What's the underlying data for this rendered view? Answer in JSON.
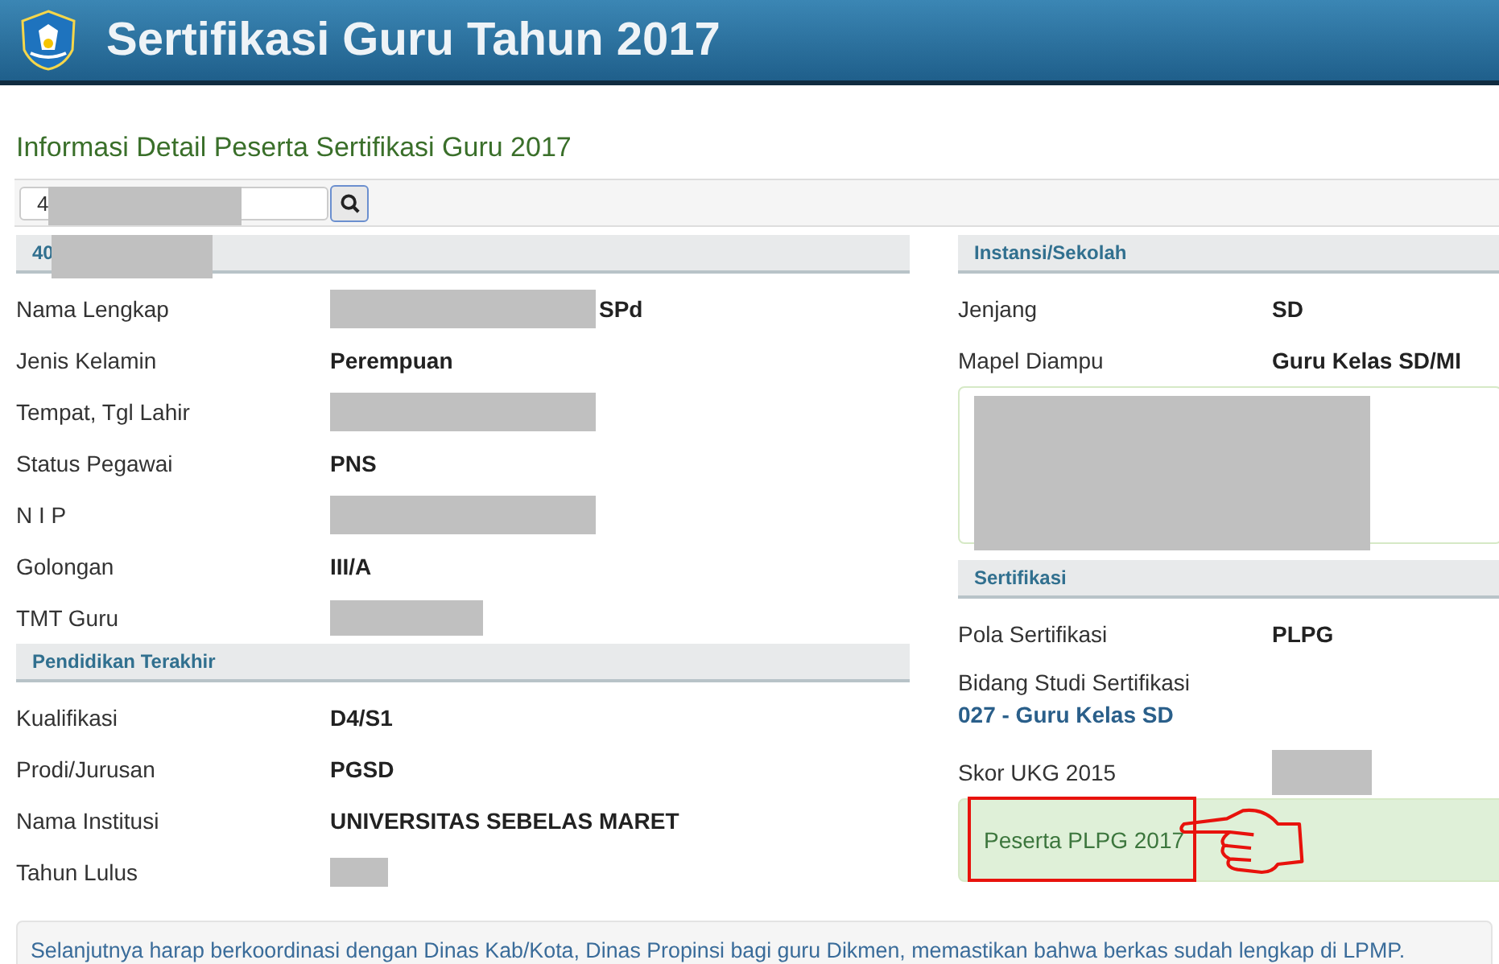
{
  "header": {
    "title": "Sertifikasi Guru Tahun 2017"
  },
  "page_title": "Informasi Detail Peserta Sertifikasi Guru 2017",
  "search": {
    "value": "4",
    "redacted": true
  },
  "left_sections": [
    {
      "heading": "40",
      "heading_redacted": true,
      "rows": [
        {
          "label": "Nama Lengkap",
          "value": "SPd",
          "redacted": true
        },
        {
          "label": "Jenis Kelamin",
          "value": "Perempuan"
        },
        {
          "label": "Tempat, Tgl Lahir",
          "redacted": true
        },
        {
          "label": "Status Pegawai",
          "value": "PNS"
        },
        {
          "label": "N I P",
          "redacted": true
        },
        {
          "label": "Golongan",
          "value": "III/A"
        },
        {
          "label": "TMT Guru",
          "redacted": true
        }
      ]
    },
    {
      "heading": "Pendidikan Terakhir",
      "rows": [
        {
          "label": "Kualifikasi",
          "value": "D4/S1"
        },
        {
          "label": "Prodi/Jurusan",
          "value": "PGSD"
        },
        {
          "label": "Nama Institusi",
          "value": "UNIVERSITAS SEBELAS MARET"
        },
        {
          "label": "Tahun Lulus",
          "redacted": true
        }
      ]
    }
  ],
  "right_sections": [
    {
      "heading": "Instansi/Sekolah",
      "items": [
        {
          "kind": "row",
          "label": "Jenjang",
          "value": "SD"
        },
        {
          "kind": "row",
          "label": "Mapel Diampu",
          "value": "Guru Kelas SD/MI"
        },
        {
          "kind": "box",
          "redacted": true
        }
      ]
    },
    {
      "heading": "Sertifikasi",
      "items": [
        {
          "kind": "row",
          "label": "Pola Sertifikasi",
          "value": "PLPG"
        },
        {
          "kind": "stacked",
          "label": "Bidang Studi Sertifikasi",
          "value": "027 - Guru Kelas SD"
        },
        {
          "kind": "row",
          "label": "Skor UKG 2015",
          "redacted": true
        },
        {
          "kind": "alert",
          "text": "Peserta PLPG 2017",
          "annotated": true
        }
      ]
    }
  ],
  "notice": "Selanjutnya harap berkoordinasi dengan Dinas Kab/Kota, Dinas Propinsi bagi guru Dikmen, memastikan bahwa berkas sudah lengkap di LPMP."
}
